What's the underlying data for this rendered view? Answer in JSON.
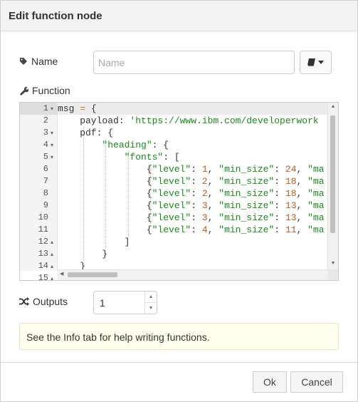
{
  "dialog": {
    "title": "Edit function node"
  },
  "name_row": {
    "label": "Name",
    "placeholder": "Name",
    "icon": "tag-icon",
    "library_icon": "book-icon"
  },
  "function_row": {
    "label": "Function",
    "icon": "wrench-icon"
  },
  "editor": {
    "line_numbers": [
      "1",
      "2",
      "3",
      "4",
      "5",
      "6",
      "7",
      "8",
      "9",
      "10",
      "11",
      "12",
      "13",
      "14",
      "15"
    ],
    "lines": [
      [
        [
          "kw",
          "msg"
        ],
        [
          "op",
          " = "
        ],
        [
          "kw",
          "{"
        ]
      ],
      [
        [
          "kw",
          "    payload: "
        ],
        [
          "str",
          "'https://www.ibm.com/developerwork"
        ]
      ],
      [
        [
          "kw",
          "    pdf: {"
        ]
      ],
      [
        [
          "kw",
          "        "
        ],
        [
          "strkey",
          "\"heading\""
        ],
        [
          "kw",
          ": {"
        ]
      ],
      [
        [
          "kw",
          "            "
        ],
        [
          "strkey",
          "\"fonts\""
        ],
        [
          "kw",
          ": ["
        ]
      ],
      [
        [
          "kw",
          "                {"
        ],
        [
          "strkey",
          "\"level\""
        ],
        [
          "kw",
          ": "
        ],
        [
          "num",
          "1"
        ],
        [
          "kw",
          ", "
        ],
        [
          "strkey",
          "\"min_size\""
        ],
        [
          "kw",
          ": "
        ],
        [
          "num",
          "24"
        ],
        [
          "kw",
          ", "
        ],
        [
          "strkey",
          "\"ma"
        ]
      ],
      [
        [
          "kw",
          "                {"
        ],
        [
          "strkey",
          "\"level\""
        ],
        [
          "kw",
          ": "
        ],
        [
          "num",
          "2"
        ],
        [
          "kw",
          ", "
        ],
        [
          "strkey",
          "\"min_size\""
        ],
        [
          "kw",
          ": "
        ],
        [
          "num",
          "18"
        ],
        [
          "kw",
          ", "
        ],
        [
          "strkey",
          "\"ma"
        ]
      ],
      [
        [
          "kw",
          "                {"
        ],
        [
          "strkey",
          "\"level\""
        ],
        [
          "kw",
          ": "
        ],
        [
          "num",
          "2"
        ],
        [
          "kw",
          ", "
        ],
        [
          "strkey",
          "\"min_size\""
        ],
        [
          "kw",
          ": "
        ],
        [
          "num",
          "18"
        ],
        [
          "kw",
          ", "
        ],
        [
          "strkey",
          "\"ma"
        ]
      ],
      [
        [
          "kw",
          "                {"
        ],
        [
          "strkey",
          "\"level\""
        ],
        [
          "kw",
          ": "
        ],
        [
          "num",
          "3"
        ],
        [
          "kw",
          ", "
        ],
        [
          "strkey",
          "\"min_size\""
        ],
        [
          "kw",
          ": "
        ],
        [
          "num",
          "13"
        ],
        [
          "kw",
          ", "
        ],
        [
          "strkey",
          "\"ma"
        ]
      ],
      [
        [
          "kw",
          "                {"
        ],
        [
          "strkey",
          "\"level\""
        ],
        [
          "kw",
          ": "
        ],
        [
          "num",
          "3"
        ],
        [
          "kw",
          ", "
        ],
        [
          "strkey",
          "\"min_size\""
        ],
        [
          "kw",
          ": "
        ],
        [
          "num",
          "13"
        ],
        [
          "kw",
          ", "
        ],
        [
          "strkey",
          "\"ma"
        ]
      ],
      [
        [
          "kw",
          "                {"
        ],
        [
          "strkey",
          "\"level\""
        ],
        [
          "kw",
          ": "
        ],
        [
          "num",
          "4"
        ],
        [
          "kw",
          ", "
        ],
        [
          "strkey",
          "\"min_size\""
        ],
        [
          "kw",
          ": "
        ],
        [
          "num",
          "11"
        ],
        [
          "kw",
          ", "
        ],
        [
          "strkey",
          "\"ma"
        ]
      ],
      [
        [
          "kw",
          "            ]"
        ]
      ],
      [
        [
          "kw",
          "        }"
        ]
      ],
      [
        [
          "kw",
          "    }"
        ]
      ],
      [
        [
          "kw",
          "}"
        ]
      ]
    ],
    "fold_down_lines": [
      1,
      3,
      4,
      5
    ],
    "fold_up_lines": [
      12,
      13,
      14,
      15
    ]
  },
  "outputs_row": {
    "label": "Outputs",
    "value": "1",
    "icon": "shuffle-icon"
  },
  "tip": {
    "text": "See the Info tab for help writing functions."
  },
  "buttons": {
    "ok": "Ok",
    "cancel": "Cancel"
  }
}
